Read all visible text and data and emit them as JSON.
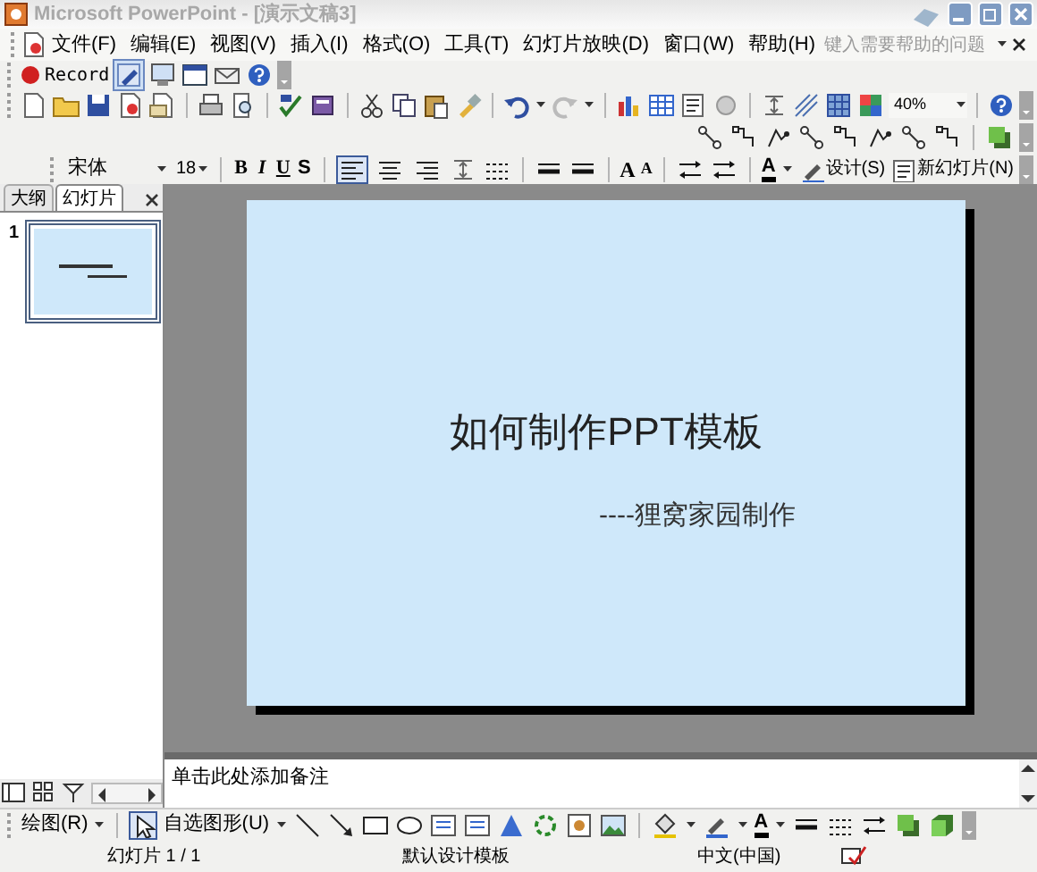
{
  "window": {
    "title": "Microsoft PowerPoint - [演示文稿3]"
  },
  "menu": [
    "文件(F)",
    "编辑(E)",
    "视图(V)",
    "插入(I)",
    "格式(O)",
    "工具(T)",
    "幻灯片放映(D)",
    "窗口(W)",
    "帮助(H)"
  ],
  "help_search": {
    "placeholder": "键入需要帮助的问题"
  },
  "record_button": {
    "label": "Record"
  },
  "zoom": {
    "value": "40%"
  },
  "formatting": {
    "font": "宋体",
    "size": "18",
    "styles": [
      "B",
      "I",
      "U",
      "S"
    ],
    "align_buttons": [
      {
        "kind": "left",
        "selected": true
      },
      {
        "kind": "center",
        "selected": false
      },
      {
        "kind": "right",
        "selected": false
      }
    ],
    "grow_font": "A",
    "shrink_font": "A",
    "font_color": "A",
    "design_button": "设计(S)",
    "new_slide_button": "新幻灯片(N)"
  },
  "panel_tabs": [
    {
      "label": "大纲",
      "selected": false
    },
    {
      "label": "幻灯片",
      "selected": true
    }
  ],
  "slides": [
    {
      "number": "1",
      "selected": true
    }
  ],
  "slide": {
    "title": "如何制作PPT模板",
    "subtitle": "----狸窝家园制作"
  },
  "notes": {
    "placeholder": "单击此处添加备注"
  },
  "drawing_toolbar": {
    "draw_menu": "绘图(R)",
    "autoshapes_menu": "自选图形(U)",
    "font_color": "A"
  },
  "status_bar": [
    "幻灯片 1 / 1",
    "默认设计模板",
    "中文(中国)"
  ]
}
